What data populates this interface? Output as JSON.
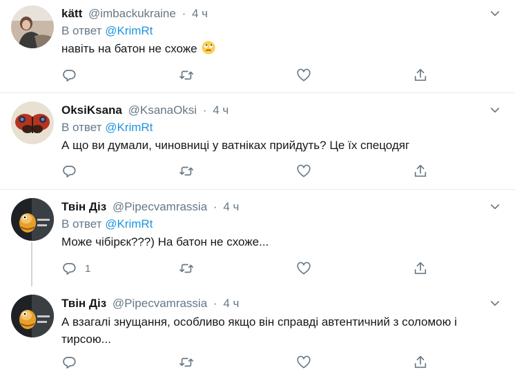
{
  "reply_prefix": "В ответ",
  "tweets": [
    {
      "name": "kätt",
      "handle": "@imbackukraine",
      "separator": "·",
      "time": "4 ч",
      "reply_to": "@KrimRt",
      "text": "навіть на батон не схоже",
      "emoji": "eye-roll-emoji",
      "reply_count": "",
      "avatar": "avatar-photo-woman"
    },
    {
      "name": "OksiKsana",
      "handle": "@KsanaOksi",
      "separator": "·",
      "time": "4 ч",
      "reply_to": "@KrimRt",
      "text": "А що ви думали, чиновниці у ватніках прийдуть? Це їх спецодяг",
      "reply_count": "",
      "avatar": "avatar-butterfly"
    },
    {
      "name": "Твін Діз",
      "handle": "@Pipecvamrassia",
      "separator": "·",
      "time": "4 ч",
      "reply_to": "@KrimRt",
      "text": "Може чібірєк???) На батон не схоже...",
      "reply_count": "1",
      "avatar": "avatar-cartoon"
    },
    {
      "name": "Твін Діз",
      "handle": "@Pipecvamrassia",
      "separator": "·",
      "time": "4 ч",
      "text": "А взагалі знущання, особливо якщо він справді автентичний з соломою і тирсою...",
      "reply_count": "",
      "avatar": "avatar-cartoon"
    }
  ],
  "icons": {
    "reply": "reply-icon",
    "retweet": "retweet-icon",
    "like": "like-icon",
    "share": "share-icon",
    "menu": "chevron-down-icon"
  },
  "colors": {
    "link": "#1b95e0",
    "muted": "#657786",
    "text": "#14171a",
    "divider": "#e6ecf0"
  }
}
